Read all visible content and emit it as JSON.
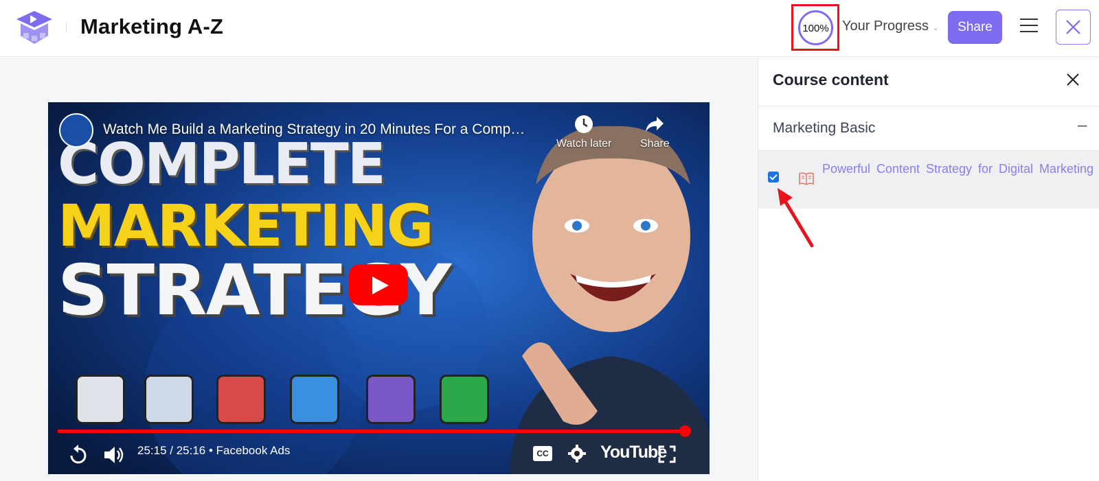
{
  "header": {
    "course_title": "Marketing A-Z",
    "progress_value": "100%",
    "progress_fraction": 1.0,
    "progress_label": "Your Progress",
    "progress_caret": "⌄",
    "share_label": "Share",
    "accent_color": "#7b6cf0"
  },
  "video": {
    "title": "Watch Me Build a Marketing Strategy in 20 Minutes For a Comp…",
    "watch_later_label": "Watch later",
    "share_label": "Share",
    "thumb_line1": "COMPLETE",
    "thumb_line2": "MARKETING",
    "thumb_line3": "STRATEGY",
    "time": "25:15 / 25:16",
    "chapter": "• Facebook Ads",
    "played_fraction": 0.999,
    "youtube_label": "YouTube",
    "cc_label": "CC"
  },
  "sidebar": {
    "title": "Course content",
    "section": {
      "label": "Marketing Basic",
      "toggle": "–"
    },
    "lesson": {
      "title": "Powerful Content Strategy for Digital Marketing",
      "checked": true,
      "icon": "book-icon"
    }
  }
}
